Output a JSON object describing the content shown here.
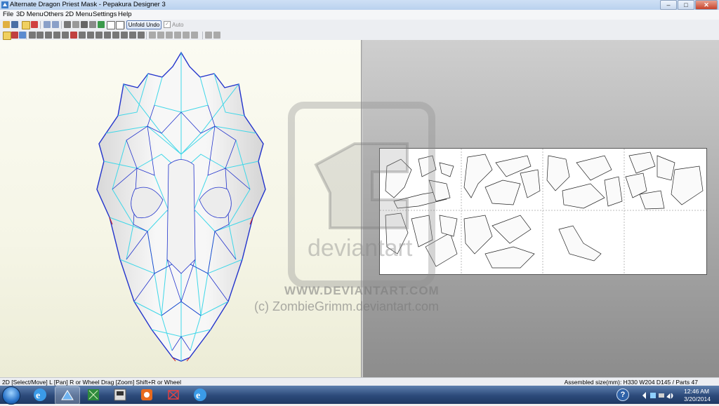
{
  "window": {
    "title": "Alternate Dragon Priest Mask - Pepakura Designer 3",
    "controls": {
      "minimize": "–",
      "maximize": "□",
      "close": "✕"
    }
  },
  "menubar": {
    "items": [
      "File",
      "3D Menu",
      "Others",
      "2D Menu",
      "Settings",
      "Help"
    ]
  },
  "toolbar": {
    "unfold_undo_label": "Unfold Undo",
    "auto_label": "Auto",
    "auto_checked": true
  },
  "watermark": {
    "line1": "WWW.DEVIANTART.COM",
    "line2": "(c) ZombieGrimm.deviantart.com",
    "logo_text": "deviantart"
  },
  "statusbar": {
    "left": "2D [Select/Move] L [Pan] R or Wheel Drag [Zoom] Shift+R or Wheel",
    "right": "Assembled size(mm): H330 W204 D145 / Parts 47"
  },
  "taskbar": {
    "apps": [
      "internet-explorer",
      "pepakura-viewer",
      "spreadsheet",
      "media-center",
      "photo-app",
      "pepakura-designer",
      "internet-explorer-2"
    ],
    "clock_time": "12:46 AM",
    "clock_date": "3/20/2014"
  },
  "colors": {
    "mesh_fill": "#ffffff",
    "mesh_edge_blue": "#2233cc",
    "mesh_edge_cyan": "#3fd7e8",
    "mesh_cut_red": "#d01010"
  }
}
